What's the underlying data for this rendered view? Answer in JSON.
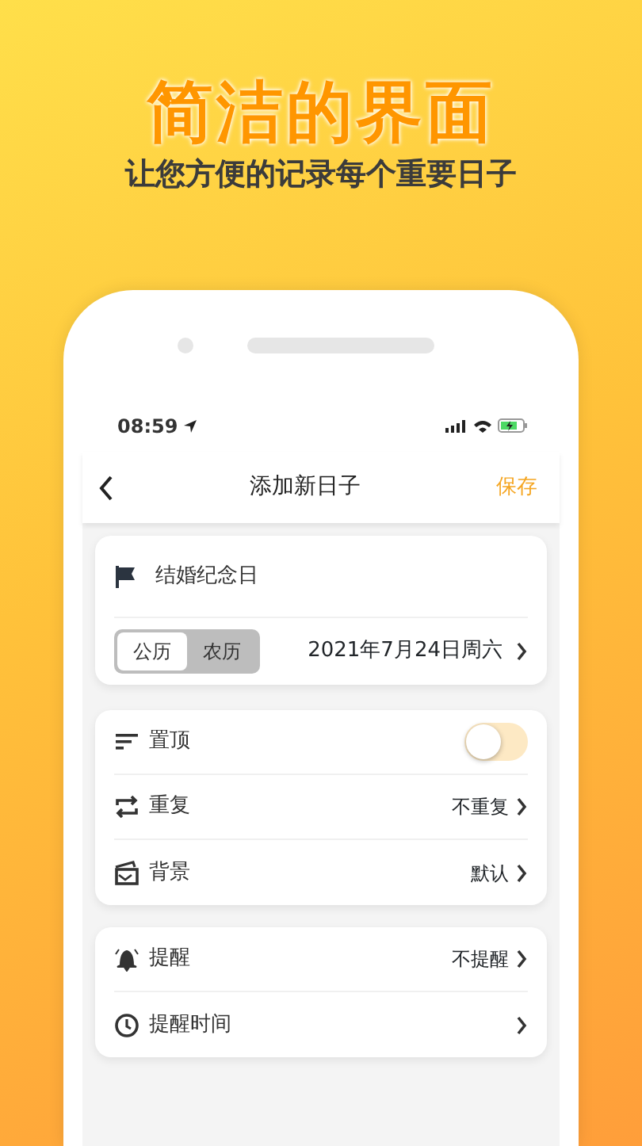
{
  "headline": "简洁的界面",
  "subheadline": "让您方便的记录每个重要日子",
  "status_bar": {
    "time": "08:59"
  },
  "nav": {
    "title": "添加新日子",
    "action": "保存"
  },
  "event": {
    "name": "结婚纪念日",
    "calendar_tabs": [
      {
        "label": "公历",
        "selected": true
      },
      {
        "label": "农历",
        "selected": false
      }
    ],
    "date": "2021年7月24日周六"
  },
  "settings": [
    {
      "kind": "toggle",
      "label": "置顶",
      "on": false
    },
    {
      "kind": "link",
      "label": "重复",
      "value": "不重复"
    },
    {
      "kind": "link",
      "label": "背景",
      "value": "默认"
    }
  ],
  "reminders": [
    {
      "kind": "link",
      "label": "提醒",
      "value": "不提醒"
    },
    {
      "kind": "link",
      "label": "提醒时间"
    }
  ]
}
